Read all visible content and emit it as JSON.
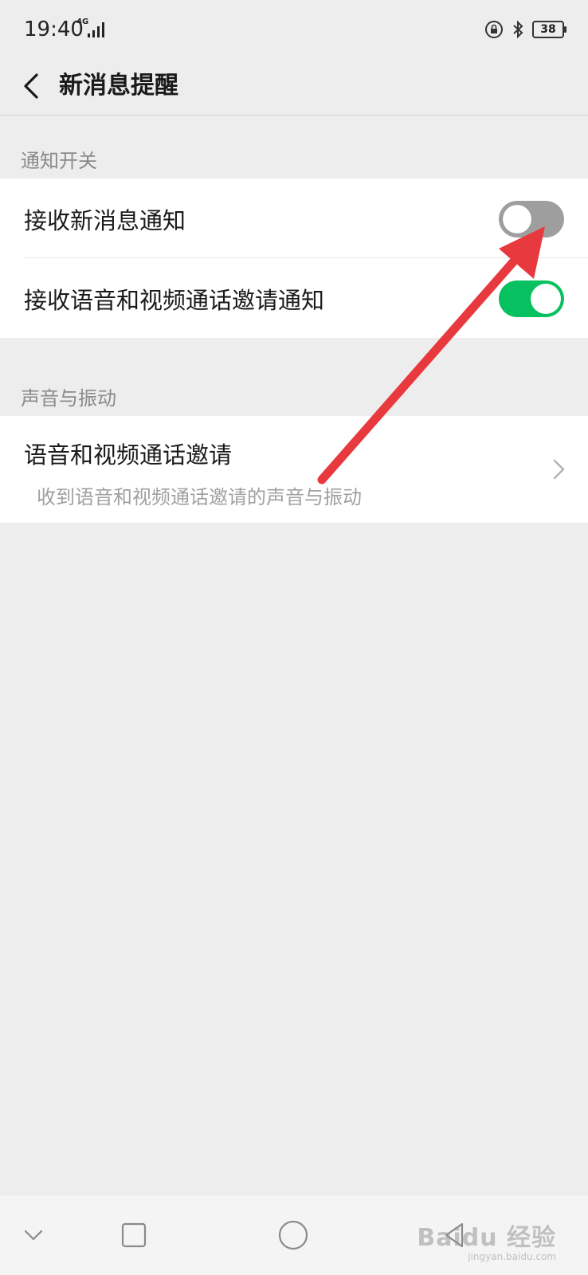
{
  "status_bar": {
    "time": "19:40",
    "network": "4G",
    "battery": "38",
    "icons": [
      "signal-icon",
      "lock-rotation-icon",
      "bluetooth-icon",
      "battery-icon"
    ]
  },
  "header": {
    "title": "新消息提醒",
    "back_icon": "back-chevron-icon"
  },
  "sections": {
    "notification": {
      "title": "通知开关",
      "items": [
        {
          "label": "接收新消息通知",
          "enabled": false
        },
        {
          "label": "接收语音和视频通话邀请通知",
          "enabled": true
        }
      ]
    },
    "sound": {
      "title": "声音与振动",
      "items": [
        {
          "label": "语音和视频通话邀请",
          "sublabel": "收到语音和视频通话邀请的声音与振动"
        }
      ]
    }
  },
  "colors": {
    "toggle_on": "#07c160",
    "toggle_off": "#9e9e9e",
    "annotation_arrow": "#e8393f",
    "background": "#ededed"
  },
  "system_nav": {
    "icons": [
      "nav-back-icon",
      "nav-recent-icon",
      "nav-home-icon",
      "nav-triangle-icon"
    ]
  },
  "watermark": {
    "brand": "Baidu 经验",
    "url": "jingyan.baidu.com"
  }
}
